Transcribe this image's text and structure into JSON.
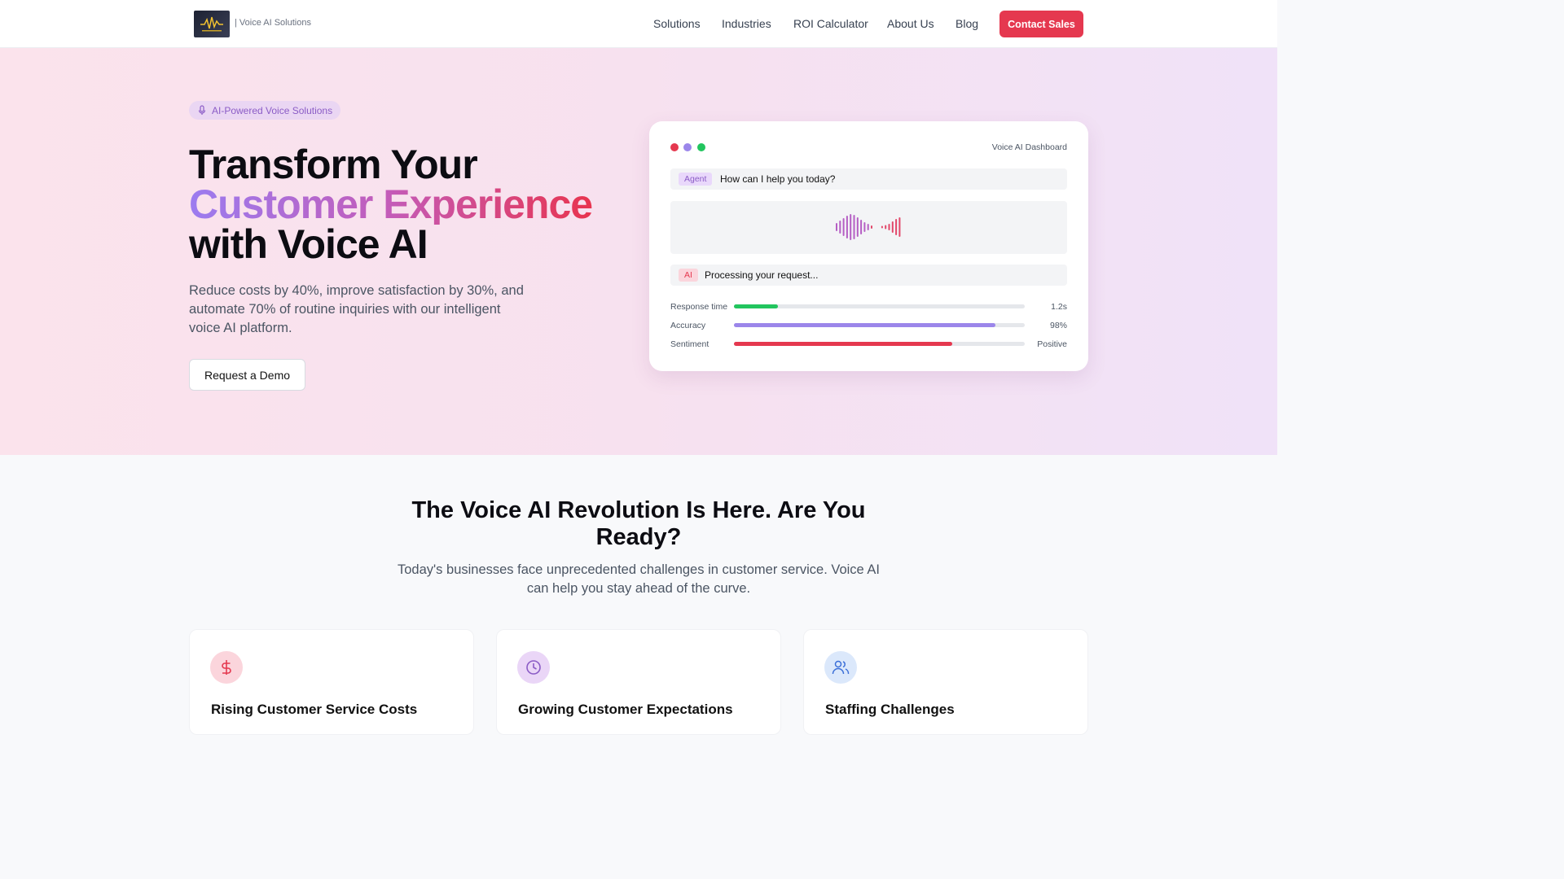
{
  "nav": {
    "brand": "| Voice AI Solutions",
    "links": [
      "Solutions",
      "Industries",
      "ROI Calculator",
      "About Us",
      "Blog"
    ],
    "cta": "Contact Sales"
  },
  "hero": {
    "badge": "AI-Powered Voice Solutions",
    "title_line1": "Transform Your",
    "title_line2": "Customer Experience",
    "title_line3": "with Voice AI",
    "lede": "Reduce costs by 40%, improve satisfaction by 30%, and automate 70% of routine inquiries with our intelligent voice AI platform.",
    "button": "Request a Demo"
  },
  "dashboard": {
    "title": "Voice AI Dashboard",
    "agent_tag": "Agent",
    "agent_msg": "How can I help you today?",
    "ai_tag": "AI",
    "ai_msg": "Processing your request...",
    "metrics": [
      {
        "label": "Response time",
        "value": "1.2s",
        "fill": 0.15,
        "color": "#22c55e"
      },
      {
        "label": "Accuracy",
        "value": "98%",
        "fill": 0.9,
        "color": "#9b86ea"
      },
      {
        "label": "Sentiment",
        "value": "Positive",
        "fill": 0.75,
        "color": "#e5384f"
      }
    ]
  },
  "section2": {
    "title": "The Voice AI Revolution Is Here. Are You Ready?",
    "subtitle": "Today's businesses face unprecedented challenges in customer service. Voice AI can help you stay ahead of the curve.",
    "cards": [
      {
        "title": "Rising Customer Service Costs",
        "icon": "dollar-icon"
      },
      {
        "title": "Growing Customer Expectations",
        "icon": "clock-icon"
      },
      {
        "title": "Staffing Challenges",
        "icon": "users-icon"
      }
    ]
  },
  "colors": {
    "accent": "#e5384f",
    "purple": "#9b7cf0"
  }
}
